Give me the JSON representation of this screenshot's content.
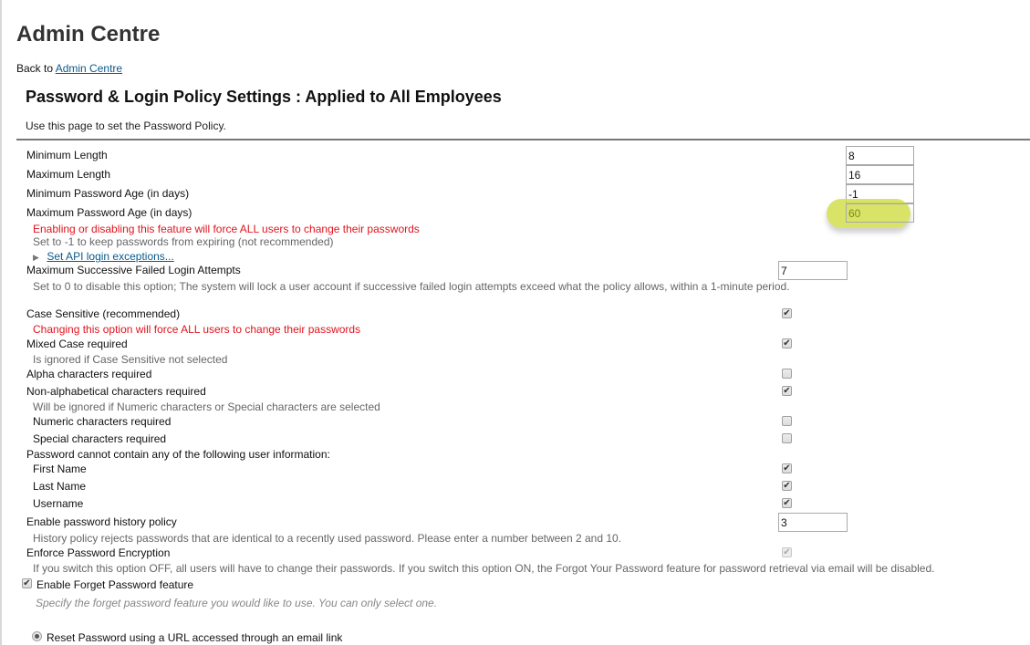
{
  "header": {
    "title": "Admin Centre",
    "back_prefix": "Back to ",
    "back_link": "Admin Centre"
  },
  "section": {
    "title": "Password & Login Policy Settings : Applied to All Employees",
    "intro": "Use this page to set the Password Policy."
  },
  "fields": {
    "min_length": {
      "label": "Minimum Length",
      "value": "8"
    },
    "max_length": {
      "label": "Maximum Length",
      "value": "16"
    },
    "min_age": {
      "label": "Minimum Password Age (in days)",
      "value": "-1"
    },
    "max_age": {
      "label": "Maximum Password Age (in days)",
      "value": "60",
      "highlight_color": "#cddb3c",
      "warning": "Enabling or disabling this feature will force ALL users to change their passwords",
      "hint": "Set to -1 to keep passwords from expiring (not recommended)",
      "api_link": "Set API login exceptions..."
    },
    "failed_attempts": {
      "label": "Maximum Successive Failed Login Attempts",
      "value": "7",
      "hint": "Set to 0 to disable this option; The system will lock a user account if successive failed login attempts exceed what the policy allows, within a 1-minute period."
    },
    "case_sensitive": {
      "label": "Case Sensitive (recommended)",
      "checked": true,
      "warning": "Changing this option will force ALL users to change their passwords"
    },
    "mixed_case": {
      "label": "Mixed Case required",
      "checked": true,
      "hint": "Is ignored if Case Sensitive not selected"
    },
    "alpha": {
      "label": "Alpha characters required",
      "checked": false
    },
    "non_alpha": {
      "label": "Non-alphabetical characters required",
      "checked": true,
      "hint": "Will be ignored if Numeric characters or Special characters are selected"
    },
    "numeric": {
      "label": "Numeric characters required",
      "checked": false
    },
    "special": {
      "label": "Special characters required",
      "checked": false
    },
    "user_info": {
      "label": "Password cannot contain any of the following user information:",
      "first_name": {
        "label": "First Name",
        "checked": true
      },
      "last_name": {
        "label": "Last Name",
        "checked": true
      },
      "username": {
        "label": "Username",
        "checked": true
      }
    },
    "history": {
      "label": "Enable password history policy",
      "value": "3",
      "hint": "History policy rejects passwords that are identical to a recently used password. Please enter a number between 2 and 10."
    },
    "encryption": {
      "label": "Enforce Password Encryption",
      "checked": true,
      "disabled": true,
      "hint": "If you switch this option OFF, all users will have to change their passwords. If you switch this option ON, the Forgot Your Password feature for password retrieval via email will be disabled."
    },
    "forget_password": {
      "label": "Enable Forget Password feature",
      "checked": true,
      "hint": "Specify the forget password feature you would like to use. You can only select one."
    },
    "reset_option": {
      "label": "Reset Password using a URL accessed through an email link",
      "selected": true
    }
  },
  "icons": {
    "check": "✔",
    "expand": "▶"
  }
}
